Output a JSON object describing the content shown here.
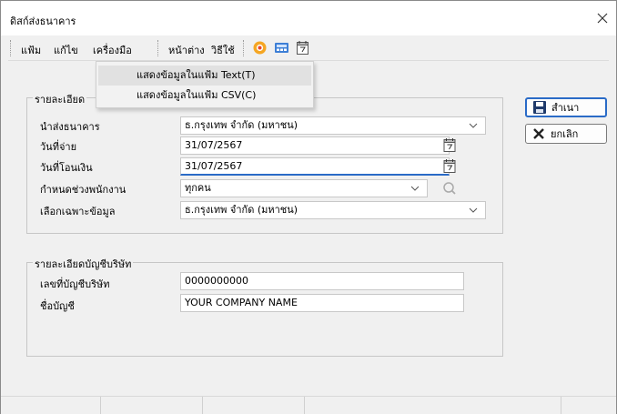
{
  "window": {
    "title": "ดิสก์ส่งธนาคาร"
  },
  "menubar": {
    "file": "แฟ้ม",
    "edit": "แก้ไข",
    "tools": "เครื่องมือ",
    "window": "หน้าต่าง",
    "help": "วิธีใช้",
    "icons": [
      "help-lifebuoy-icon",
      "calculator-icon",
      "calendar-icon"
    ]
  },
  "dropdown": {
    "items": [
      "แสดงข้อมูลในแฟ้ม Text(T)",
      "แสดงข้อมูลในแฟ้ม CSV(C)"
    ]
  },
  "details_panel": {
    "title": "รายละเอียด",
    "bank_label": "นำส่งธนาคาร",
    "bank_value": "ธ.กรุงเทพ จำกัด (มหาชน)",
    "pay_date_label": "วันที่จ่าย",
    "pay_date_value": "31/07/2567",
    "transfer_date_label": "วันที่โอนเงิน",
    "transfer_date_value": "31/07/2567",
    "employee_range_label": "กำหนดช่วงพนักงาน",
    "employee_range_value": "ทุกคน",
    "filter_label": "เลือกเฉพาะข้อมูล",
    "filter_value": "ธ.กรุงเทพ จำกัด (มหาชน)"
  },
  "company_panel": {
    "title": "รายละเอียดบัญชีบริษัท",
    "account_no_label": "เลขที่บัญชีบริษัท",
    "account_no_value": "0000000000",
    "account_name_label": "ชื่อบัญชี",
    "account_name_value": "YOUR COMPANY NAME"
  },
  "buttons": {
    "save": "สำเนา",
    "cancel": "ยกเลิก"
  },
  "colors": {
    "accent": "#2a6bc7",
    "background": "#f0f0f0"
  }
}
